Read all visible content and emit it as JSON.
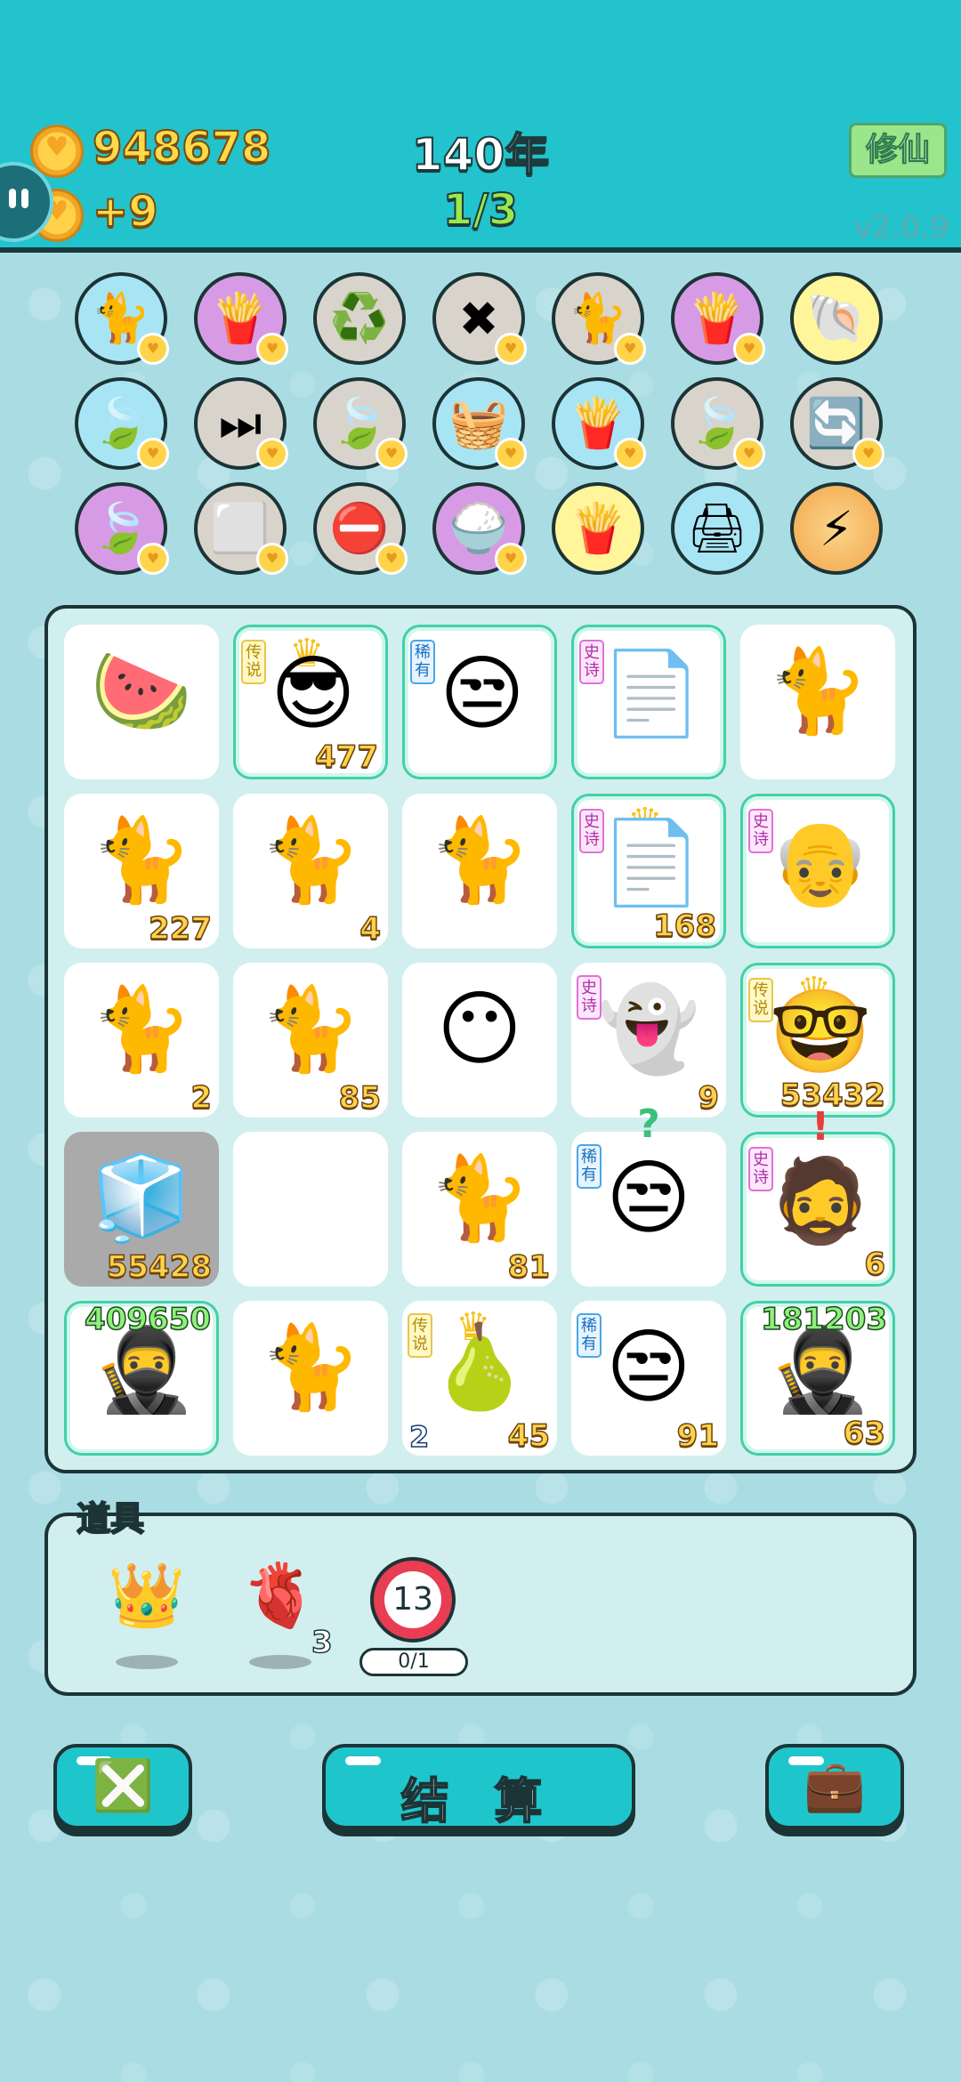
{
  "header": {
    "coins": "948678",
    "income": "+9",
    "year": "140年",
    "round": "1/3",
    "mode_button": "修仙",
    "version": "v2.0.9"
  },
  "perks": [
    {
      "icon": "🐈",
      "bg": "p-blue",
      "badge": true
    },
    {
      "icon": "🍟",
      "bg": "p-purple",
      "badge": true
    },
    {
      "icon": "♻️",
      "bg": "p-gray",
      "badge": false
    },
    {
      "icon": "✖",
      "bg": "p-gray",
      "badge": true
    },
    {
      "icon": "🐈",
      "bg": "p-gray",
      "badge": true
    },
    {
      "icon": "🍟",
      "bg": "p-purple",
      "badge": true
    },
    {
      "icon": "🐚",
      "bg": "p-yellow",
      "badge": false
    },
    {
      "icon": "🍃",
      "bg": "p-blue",
      "badge": true
    },
    {
      "icon": "⏭",
      "bg": "p-gray",
      "badge": true
    },
    {
      "icon": "🍃",
      "bg": "p-gray",
      "badge": true
    },
    {
      "icon": "🧺",
      "bg": "p-blue",
      "badge": true
    },
    {
      "icon": "🍟",
      "bg": "p-blue",
      "badge": true
    },
    {
      "icon": "🍃",
      "bg": "p-gray",
      "badge": true
    },
    {
      "icon": "🔄",
      "bg": "p-gray",
      "badge": true
    },
    {
      "icon": "🍃",
      "bg": "p-purple",
      "badge": true
    },
    {
      "icon": "⬜",
      "bg": "p-gray",
      "badge": true
    },
    {
      "icon": "⛔",
      "bg": "p-gray",
      "badge": true
    },
    {
      "icon": "🍚",
      "bg": "p-purple",
      "badge": true
    },
    {
      "icon": "🍟",
      "bg": "p-yellow",
      "badge": false
    },
    {
      "icon": "🖨",
      "bg": "p-blue",
      "badge": false
    },
    {
      "icon": "⚡",
      "bg": "p-orange",
      "badge": false
    }
  ],
  "tags": {
    "legend": "传说",
    "rare": "稀有",
    "epic": "史诗"
  },
  "board": [
    {
      "icon": "🍉",
      "num": "",
      "hl": false
    },
    {
      "icon": "😎",
      "num": "477",
      "hl": true,
      "tag": "legend",
      "crown": true
    },
    {
      "icon": "😒",
      "num": "",
      "hl": true,
      "tag": "rare"
    },
    {
      "icon": "📄",
      "num": "",
      "hl": true,
      "tag": "epic"
    },
    {
      "icon": "🐈",
      "num": "",
      "hl": false
    },
    {
      "icon": "🐈",
      "num": "227",
      "hl": false
    },
    {
      "icon": "🐈",
      "num": "4",
      "hl": false
    },
    {
      "icon": "🐈",
      "num": "",
      "hl": false
    },
    {
      "icon": "📄",
      "num": "168",
      "hl": true,
      "tag": "epic",
      "crown": true
    },
    {
      "icon": "👴",
      "num": "",
      "hl": true,
      "tag": "epic"
    },
    {
      "icon": "🐈",
      "num": "2",
      "hl": false
    },
    {
      "icon": "🐈",
      "num": "85",
      "hl": false
    },
    {
      "icon": "😶",
      "num": "",
      "hl": false
    },
    {
      "icon": "👻",
      "num": "9",
      "hl": false,
      "tag": "epic"
    },
    {
      "icon": "🤓",
      "num": "53432",
      "hl": true,
      "tag": "legend",
      "crown": true
    },
    {
      "icon": "🧊",
      "num": "55428",
      "hl": false,
      "gray": true
    },
    {
      "icon": "",
      "num": "",
      "hl": false
    },
    {
      "icon": "🐈",
      "num": "81",
      "hl": false
    },
    {
      "icon": "😒",
      "num": "",
      "hl": false,
      "tag": "rare",
      "mark": "?"
    },
    {
      "icon": "🧔",
      "num": "6",
      "hl": true,
      "tag": "epic",
      "mark": "!"
    },
    {
      "icon": "🥷",
      "num": "",
      "hl": true,
      "top": "409650"
    },
    {
      "icon": "🐈",
      "num": "",
      "hl": false
    },
    {
      "icon": "🍐",
      "num": "45",
      "hl": false,
      "tag": "legend",
      "crown": true,
      "bl": "2"
    },
    {
      "icon": "😒",
      "num": "91",
      "hl": false,
      "tag": "rare"
    },
    {
      "icon": "🥷",
      "num": "63",
      "hl": true,
      "top": "181203"
    }
  ],
  "items": {
    "title": "道具",
    "liver_count": "3",
    "ticket_number": "13",
    "ticket_progress": "0/1"
  },
  "buttons": {
    "settle": "结 算"
  }
}
